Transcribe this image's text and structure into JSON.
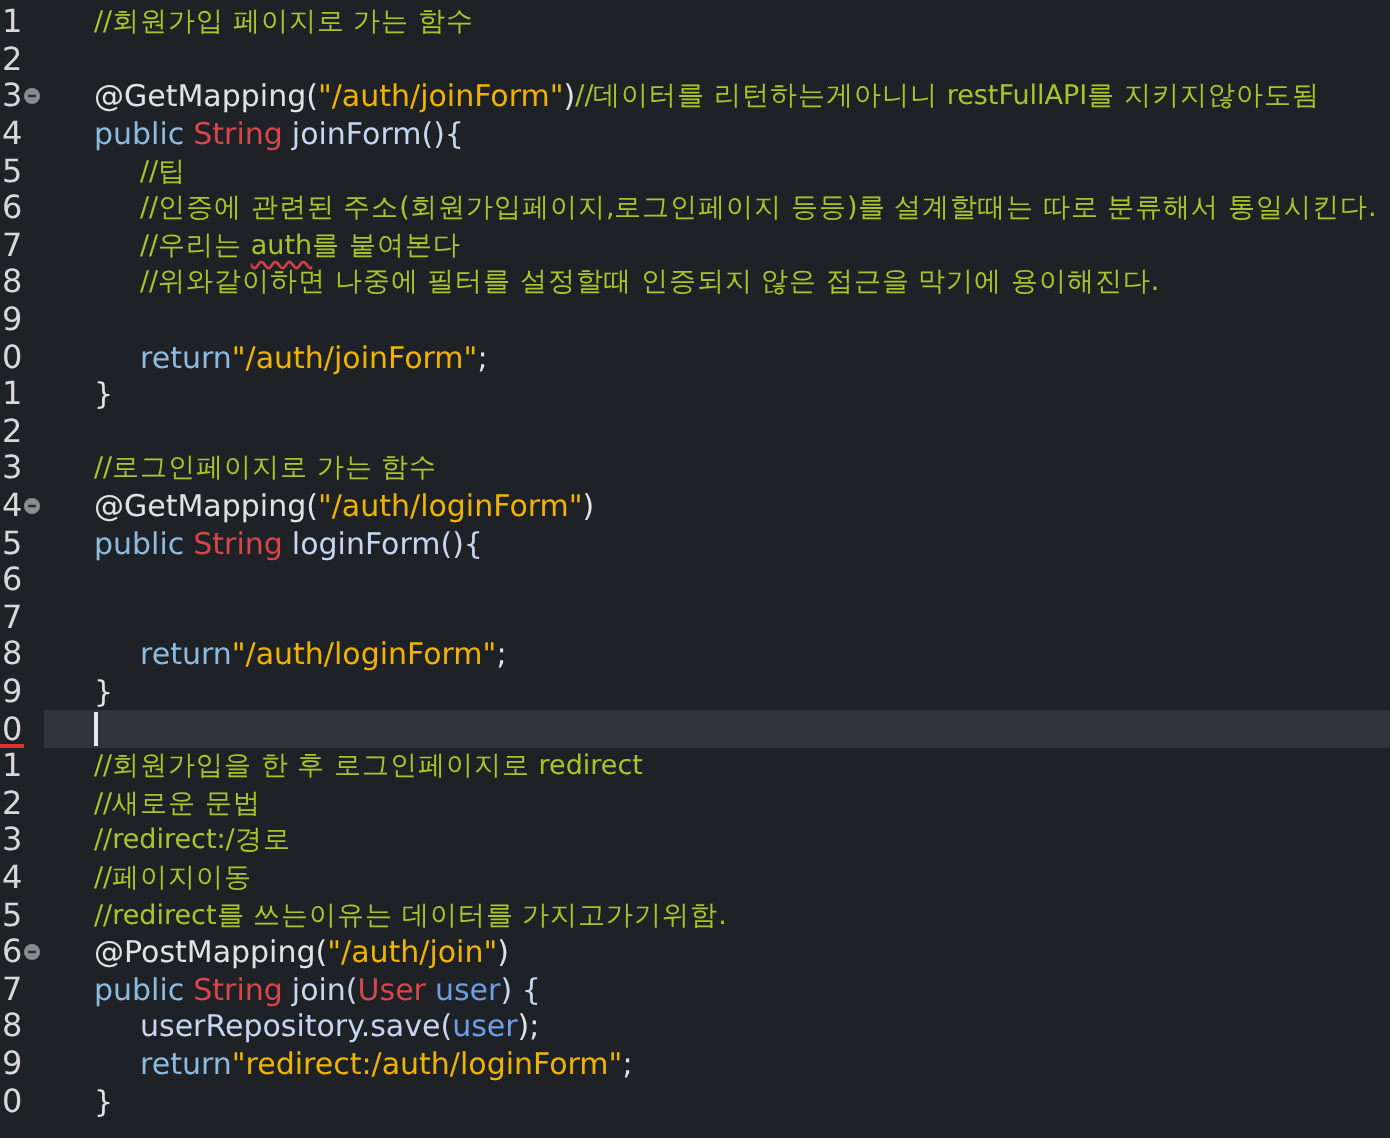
{
  "lines": [
    {
      "number": "1",
      "kind": "member",
      "tokens": [
        {
          "kind": "comment",
          "text": "//회원가입 페이지로 가는 함수"
        }
      ]
    },
    {
      "number": "2",
      "kind": "member"
    },
    {
      "number": "3",
      "kind": "member",
      "fold": true,
      "tokens": [
        {
          "kind": "plain",
          "text": "@GetMapping("
        },
        {
          "kind": "string",
          "text": "\"/auth/joinForm\""
        },
        {
          "kind": "plain",
          "text": ")"
        },
        {
          "kind": "comment",
          "text": "//데이터를 리턴하는게아니니 restFullAPI를 지키지않아도됨"
        }
      ]
    },
    {
      "number": "4",
      "kind": "member",
      "tokens": [
        {
          "kind": "keyword",
          "text": "public"
        },
        {
          "kind": "type",
          "text": "String"
        },
        {
          "kind": "method",
          "text": "joinForm(){"
        }
      ]
    },
    {
      "number": "5",
      "kind": "body",
      "tokens": [
        {
          "kind": "comment",
          "text": "//팁"
        }
      ]
    },
    {
      "number": "6",
      "kind": "body",
      "tokens": [
        {
          "kind": "comment",
          "text": "//인증에 관련된 주소(회원가입페이지,로그인페이지 등등)를 설계할때는 따로 분류해서 통일시킨다."
        }
      ]
    },
    {
      "number": "7",
      "kind": "body",
      "tokens": [
        {
          "kind": "comment",
          "text": "//우리는 "
        },
        {
          "kind": "comment",
          "text": "auth",
          "misspelled": true
        },
        {
          "kind": "comment",
          "text": "를 붙여본다"
        }
      ]
    },
    {
      "number": "8",
      "kind": "body",
      "tokens": [
        {
          "kind": "comment",
          "text": "//위와같이하면 나중에 필터를 설정할때 인증되지 않은 접근을 막기에 용이해진다."
        }
      ]
    },
    {
      "number": "9",
      "kind": "body"
    },
    {
      "number": "0",
      "kind": "body",
      "tokens": [
        {
          "kind": "keyword",
          "text": "return"
        },
        {
          "kind": "string",
          "text": "\"/auth/joinForm\""
        },
        {
          "kind": "plain",
          "text": ";"
        }
      ]
    },
    {
      "number": "1",
      "kind": "member",
      "tokens": [
        {
          "kind": "plain",
          "text": "}"
        }
      ]
    },
    {
      "number": "2",
      "kind": "member"
    },
    {
      "number": "3",
      "kind": "member",
      "tokens": [
        {
          "kind": "comment",
          "text": "//로그인페이지로 가는 함수"
        }
      ]
    },
    {
      "number": "4",
      "kind": "member",
      "fold": true,
      "tokens": [
        {
          "kind": "plain",
          "text": "@GetMapping("
        },
        {
          "kind": "string",
          "text": "\"/auth/loginForm\""
        },
        {
          "kind": "plain",
          "text": ")"
        }
      ]
    },
    {
      "number": "5",
      "kind": "member",
      "tokens": [
        {
          "kind": "keyword",
          "text": "public"
        },
        {
          "kind": "type",
          "text": "String"
        },
        {
          "kind": "method",
          "text": "loginForm(){"
        }
      ]
    },
    {
      "number": "6",
      "kind": "member"
    },
    {
      "number": "7",
      "kind": "member"
    },
    {
      "number": "8",
      "kind": "body",
      "tokens": [
        {
          "kind": "keyword",
          "text": "return"
        },
        {
          "kind": "string",
          "text": "\"/auth/loginForm\""
        },
        {
          "kind": "plain",
          "text": ";"
        }
      ]
    },
    {
      "number": "9",
      "kind": "member",
      "tokens": [
        {
          "kind": "plain",
          "text": "}"
        }
      ]
    },
    {
      "number": "0",
      "kind": "member",
      "current": true,
      "error_mark": true
    },
    {
      "number": "1",
      "kind": "member",
      "tokens": [
        {
          "kind": "comment",
          "text": "//회원가입을 한 후 로그인페이지로 redirect"
        }
      ]
    },
    {
      "number": "2",
      "kind": "member",
      "tokens": [
        {
          "kind": "comment",
          "text": "//새로운 문법"
        }
      ]
    },
    {
      "number": "3",
      "kind": "member",
      "tokens": [
        {
          "kind": "comment",
          "text": "//redirect:/경로"
        }
      ]
    },
    {
      "number": "4",
      "kind": "member",
      "tokens": [
        {
          "kind": "comment",
          "text": "//페이지이동"
        }
      ]
    },
    {
      "number": "5",
      "kind": "member",
      "tokens": [
        {
          "kind": "comment",
          "text": "//redirect를 쓰는이유는 데이터를 가지고가기위함."
        }
      ]
    },
    {
      "number": "6",
      "kind": "member",
      "fold": true,
      "tokens": [
        {
          "kind": "plain",
          "text": "@PostMapping("
        },
        {
          "kind": "string",
          "text": "\"/auth/join\""
        },
        {
          "kind": "plain",
          "text": ")"
        }
      ]
    },
    {
      "number": "7",
      "kind": "member",
      "tokens": [
        {
          "kind": "keyword",
          "text": "public"
        },
        {
          "kind": "type",
          "text": "String"
        },
        {
          "kind": "method",
          "text": "join("
        },
        {
          "kind": "type",
          "text": "User"
        },
        {
          "kind": "param",
          "text": "user"
        },
        {
          "kind": "method",
          "text": ") {"
        }
      ]
    },
    {
      "number": "8",
      "kind": "body",
      "tokens": [
        {
          "kind": "method",
          "text": "userRepository.save("
        },
        {
          "kind": "param",
          "text": "user"
        },
        {
          "kind": "plain",
          "text": ");"
        }
      ]
    },
    {
      "number": "9",
      "kind": "body",
      "tokens": [
        {
          "kind": "keyword",
          "text": "return"
        },
        {
          "kind": "string",
          "text": "\"redirect:/auth/loginForm\""
        },
        {
          "kind": "plain",
          "text": ";"
        }
      ]
    },
    {
      "number": "0",
      "kind": "member",
      "tokens": [
        {
          "kind": "plain",
          "text": "}"
        }
      ]
    }
  ]
}
